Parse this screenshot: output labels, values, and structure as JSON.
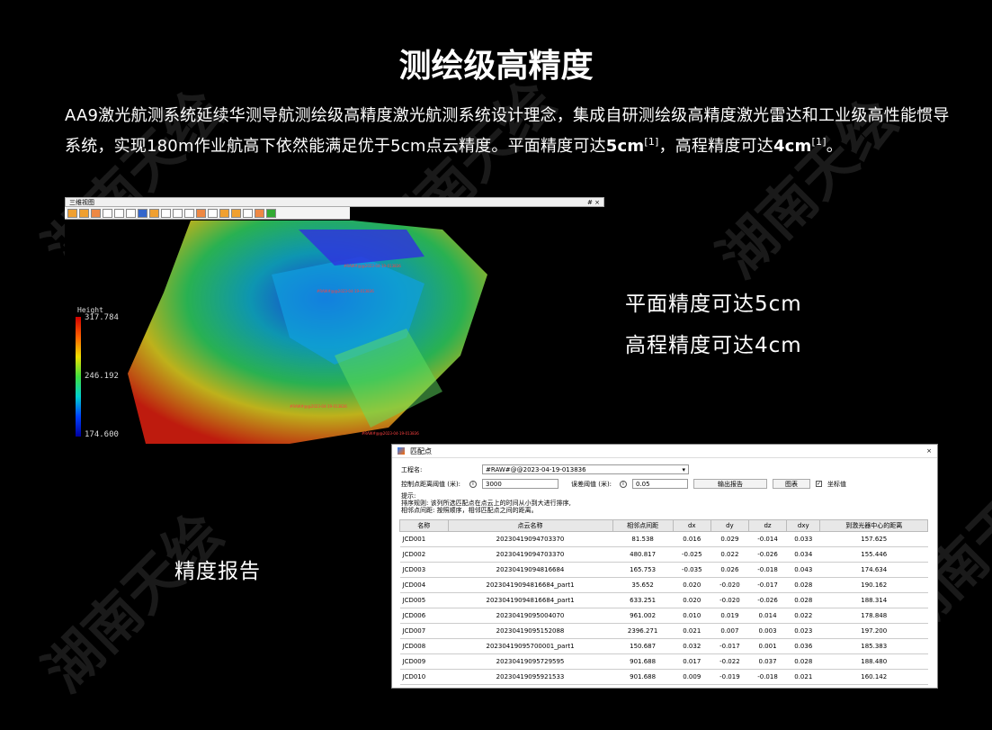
{
  "watermark": "湖南天绘",
  "title": "测绘级高精度",
  "intro": {
    "part1": "AA9激光航测系统延续华测导航测绘级高精度激光航测系统设计理念，集成自研测绘级高精度激光雷达和工业级高性能惯导系统，实现180m作业航高下依然能满足优于5cm点云精度。平面精度可达",
    "val1": "5cm",
    "ref1": "[1]",
    "part2": "，高程精度可达",
    "val2": "4cm",
    "ref2": "[1]",
    "part3": "。"
  },
  "viewer": {
    "title": "三维视图",
    "controls": "# ×",
    "legend": {
      "title": "Height",
      "max": "317.784",
      "mid": "246.192",
      "min": "174.600"
    },
    "labels": [
      "#RAW#@@2023-04-19-013836",
      "#RAW#@@2023-04-19-013836",
      "#RAW#@@2023-04-19-013836",
      "#RAW#@@2023-04-19-013836"
    ]
  },
  "side": {
    "plane": "平面精度可达5cm",
    "height": "高程精度可达4cm"
  },
  "report_label": "精度报告",
  "dialog": {
    "title": "匹配点",
    "close": "×",
    "project_label": "工程名:",
    "project_value": "#RAW#@@2023-04-19-013836",
    "dist_label": "控制点距离阈值 (米):",
    "dist_value": "3000",
    "err_label": "误差阈值 (米):",
    "err_value": "0.05",
    "export_btn": "输出报告",
    "chart_btn": "图表",
    "coord_label": "坐标值",
    "hint_title": "提示:",
    "hint1": "排序规则: 该列所选匹配点在点云上的时间从小到大进行排序,",
    "hint2": "相邻点间距: 按照顺序，相邻匹配点之间的距离。",
    "columns": [
      "名称",
      "点云名称",
      "相邻点间距",
      "dx",
      "dy",
      "dz",
      "dxy",
      "到激光器中心的距离"
    ],
    "rows": [
      [
        "JCD001",
        "20230419094703370",
        "81.538",
        "0.016",
        "0.029",
        "-0.014",
        "0.033",
        "157.625"
      ],
      [
        "JCD002",
        "20230419094703370",
        "480.817",
        "-0.025",
        "0.022",
        "-0.026",
        "0.034",
        "155.446"
      ],
      [
        "JCD003",
        "20230419094816684",
        "165.753",
        "-0.035",
        "0.026",
        "-0.018",
        "0.043",
        "174.634"
      ],
      [
        "JCD004",
        "20230419094816684_part1",
        "35.652",
        "0.020",
        "-0.020",
        "-0.017",
        "0.028",
        "190.162"
      ],
      [
        "JCD005",
        "20230419094816684_part1",
        "633.251",
        "0.020",
        "-0.020",
        "-0.026",
        "0.028",
        "188.314"
      ],
      [
        "JCD006",
        "20230419095004070",
        "961.002",
        "0.010",
        "0.019",
        "0.014",
        "0.022",
        "178.848"
      ],
      [
        "JCD007",
        "20230419095152088",
        "2396.271",
        "0.021",
        "0.007",
        "0.003",
        "0.023",
        "197.200"
      ],
      [
        "JCD008",
        "20230419095700001_part1",
        "150.687",
        "0.032",
        "-0.017",
        "0.001",
        "0.036",
        "185.383"
      ],
      [
        "JCD009",
        "20230419095729595",
        "901.688",
        "0.017",
        "-0.022",
        "0.037",
        "0.028",
        "188.480"
      ],
      [
        "JCD010",
        "20230419095921533",
        "901.688",
        "0.009",
        "-0.019",
        "-0.018",
        "0.021",
        "160.142"
      ]
    ]
  }
}
